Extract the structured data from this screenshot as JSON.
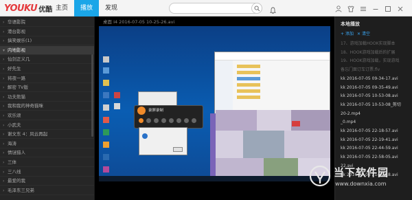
{
  "app": {
    "logo_en": "YOUKU",
    "logo_cn": "优酷"
  },
  "nav": {
    "tabs": [
      {
        "label": "主页"
      },
      {
        "label": "播放"
      },
      {
        "label": "发现"
      }
    ]
  },
  "colors": {
    "accent": "#1ba6e8",
    "logo_red": "#e43a3d",
    "link_blue": "#3aa4f0"
  },
  "sidebar": {
    "items": [
      {
        "label": "华语影院",
        "count": ""
      },
      {
        "label": "港台影视",
        "count": ""
      },
      {
        "label": "搞笑娱乐(1)",
        "count": ""
      },
      {
        "label": "内地影视",
        "count": ""
      },
      {
        "label": "仙剑正义几",
        "count": ""
      },
      {
        "label": "好先生",
        "count": ""
      },
      {
        "label": "将夜一路",
        "count": ""
      },
      {
        "label": "解密 TV版",
        "count": ""
      },
      {
        "label": "功夫熊猫",
        "count": ""
      },
      {
        "label": "我和我的神奇猫咪",
        "count": ""
      },
      {
        "label": "欢乐颂",
        "count": ""
      },
      {
        "label": "小武夫",
        "count": ""
      },
      {
        "label": "谢文东 4：风云再起",
        "count": ""
      },
      {
        "label": "海涛",
        "count": ""
      },
      {
        "label": "情谜猎人",
        "count": ""
      },
      {
        "label": "三体",
        "count": ""
      },
      {
        "label": "三八线",
        "count": ""
      },
      {
        "label": "最爱的我",
        "count": ""
      },
      {
        "label": "毛泽东三兄弟",
        "count": ""
      }
    ]
  },
  "player": {
    "video_title": "桌面  I4  2016-07-05  10-25-26.avi",
    "recorder_title": "录屏录制"
  },
  "right_panel": {
    "title": "本地播放",
    "add_label": "添加",
    "clear_label": "清空",
    "items": [
      {
        "label": "17、游戏加载HOOK实现脚本",
        "dim": true
      },
      {
        "label": "18、HOOK游戏加载后的扩展",
        "dim": true
      },
      {
        "label": "19、HOOK游戏加载，实现游戏",
        "dim": true
      },
      {
        "label": "备忘门面订车订票.flv",
        "dim": true
      },
      {
        "label": "kk 2016-07-05 09-34-17.avi",
        "dim": false
      },
      {
        "label": "kk 2016-07-05 09-35-49.avi",
        "dim": false
      },
      {
        "label": "kk 2016-07-05 10-53-08.avi",
        "dim": false
      },
      {
        "label": "kk 2016-07-05 10-53-08_剪切",
        "dim": false
      },
      {
        "label": "20-2.mp4",
        "dim": false
      },
      {
        "label": "_0.mp4",
        "dim": false
      },
      {
        "label": "kk 2016-07-05 22-18-57.avi",
        "dim": false
      },
      {
        "label": "kk 2016-07-05 22-19-41.avi",
        "dim": false
      },
      {
        "label": "kk 2016-07-05 22-44-59.avi",
        "dim": false
      },
      {
        "label": "kk 2016-07-05 22-58-05.avi",
        "dim": false
      },
      {
        "label": "22.avi",
        "dim": false
      },
      {
        "label": "kk 2016-07-06 21-39-18.avi",
        "dim": false
      }
    ]
  },
  "watermark": {
    "name": "当下软件园",
    "url": "www.downxia.com"
  }
}
